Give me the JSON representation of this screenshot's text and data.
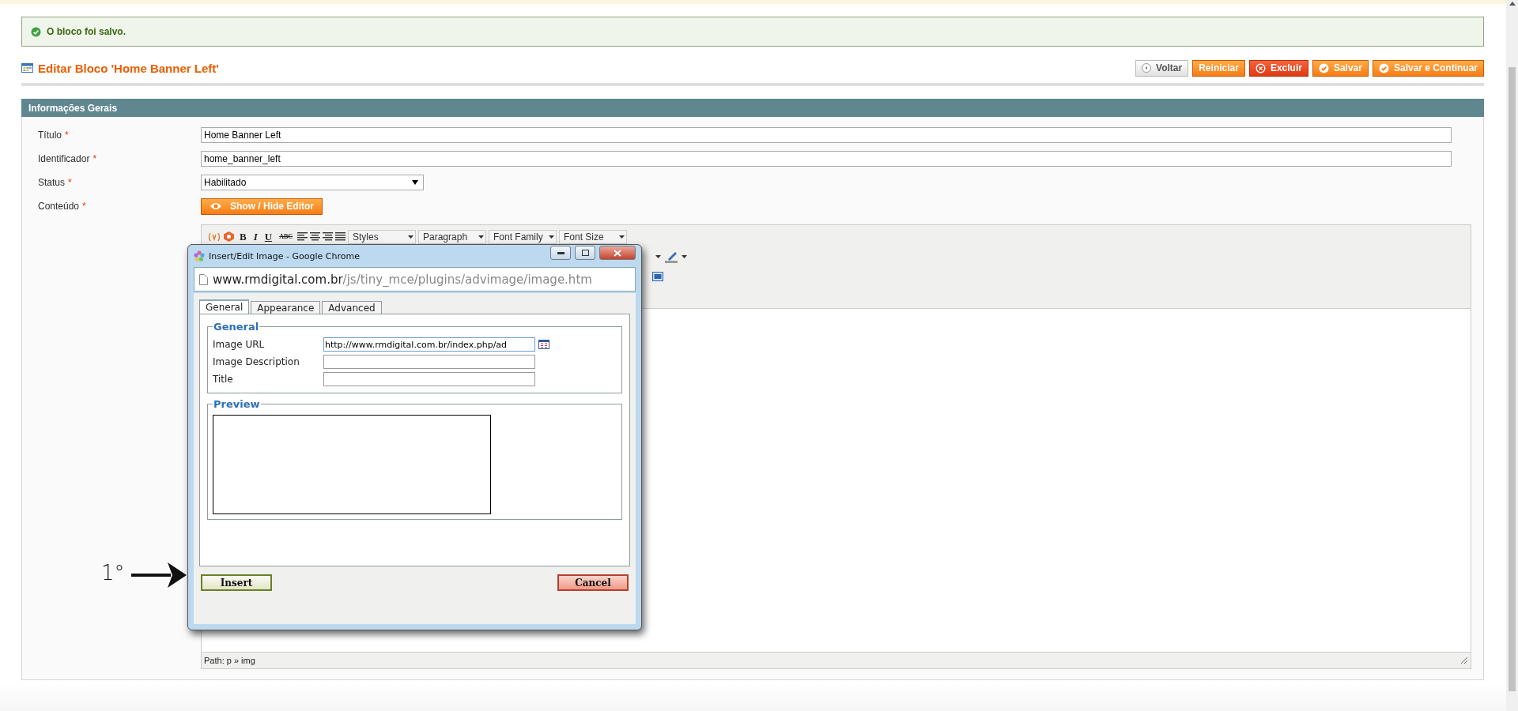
{
  "notice": {
    "text": "O bloco foi salvo."
  },
  "page_title": "Editar Bloco 'Home Banner Left'",
  "actions": [
    {
      "label": "Voltar",
      "kind": "back"
    },
    {
      "label": "Reiniciar",
      "kind": "reset"
    },
    {
      "label": "Excluir",
      "kind": "delete"
    },
    {
      "label": "Salvar",
      "kind": "save"
    },
    {
      "label": "Salvar e Continuar",
      "kind": "save"
    }
  ],
  "section": {
    "title": "Informações Gerais",
    "fields": [
      {
        "label": "Título",
        "mark": "*",
        "kind": "text",
        "value": "Home Banner Left"
      },
      {
        "label": "Identificador",
        "mark": "*",
        "kind": "text",
        "value": "home_banner_left"
      },
      {
        "label": "Status",
        "mark": "*",
        "kind": "select",
        "value": "Habilitado"
      },
      {
        "label": "Conteúdo",
        "mark": "*",
        "kind": "button",
        "value": "Show / Hide Editor"
      }
    ]
  },
  "editor": {
    "format_buttons": [
      {
        "label": "B",
        "kind": "bold"
      },
      {
        "label": "I",
        "kind": "italic"
      },
      {
        "label": "U",
        "kind": "underline"
      },
      {
        "label": "ABC",
        "kind": "strike"
      }
    ],
    "selects": [
      "Styles",
      "Paragraph",
      "Font Family",
      "Font Size"
    ],
    "path": "Path: p » img"
  },
  "dialog": {
    "title": "Insert/Edit Image - Google Chrome",
    "url_host": "www.rmdigital.com.br",
    "url_path": "/js/tiny_mce/plugins/advimage/image.htm",
    "tabs": [
      {
        "label": "General",
        "selected": true
      },
      {
        "label": "Appearance",
        "selected": false
      },
      {
        "label": "Advanced",
        "selected": false
      }
    ],
    "general": {
      "legend": "General",
      "fields": [
        {
          "label": "Image URL",
          "value": "http://www.rmdigital.com.br/index.php/ad",
          "browse": true
        },
        {
          "label": "Image Description"
        },
        {
          "label": "Title"
        }
      ]
    },
    "preview": {
      "legend": "Preview"
    },
    "insert": "Insert",
    "cancel": "Cancel"
  },
  "annotation": {
    "text": "1°"
  }
}
